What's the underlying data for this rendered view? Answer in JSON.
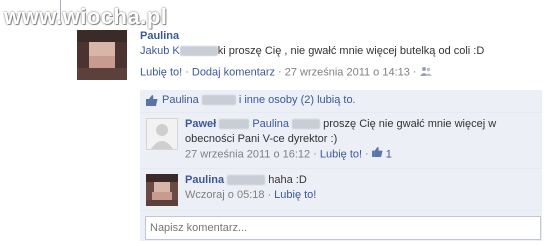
{
  "watermark": "www.wiocha.pl",
  "post": {
    "author": "Paulina",
    "text_prefix": "Jakub K",
    "text_suffix": "ki proszę Cię , nie gwałć mnie więcej butelką od coli :D",
    "like_link": "Lubię to!",
    "comment_link": "Dodaj komentarz",
    "timestamp": "27 września 2011 o 14:13",
    "separator": "·"
  },
  "likes": {
    "name": "Paulina",
    "text": "i inne osoby (2) lubią to."
  },
  "comments": [
    {
      "author": "Paweł",
      "text_a": "Paulina",
      "text_b": "proszę Cię nie gwałć mnie więcej w obecności Pani V-ce dyrektor :)",
      "timestamp": "27 września 2011 o 16:12",
      "like_link": "Lubię to!",
      "like_count": "1"
    },
    {
      "author": "Paulina",
      "text": "haha :D",
      "timestamp": "Wczoraj o 05:18",
      "like_link": "Lubię to!"
    }
  ],
  "comment_input": {
    "placeholder": "Napisz komentarz..."
  },
  "colors": {
    "link": "#3b5998",
    "panel": "#eceff5",
    "muted": "#808080"
  }
}
